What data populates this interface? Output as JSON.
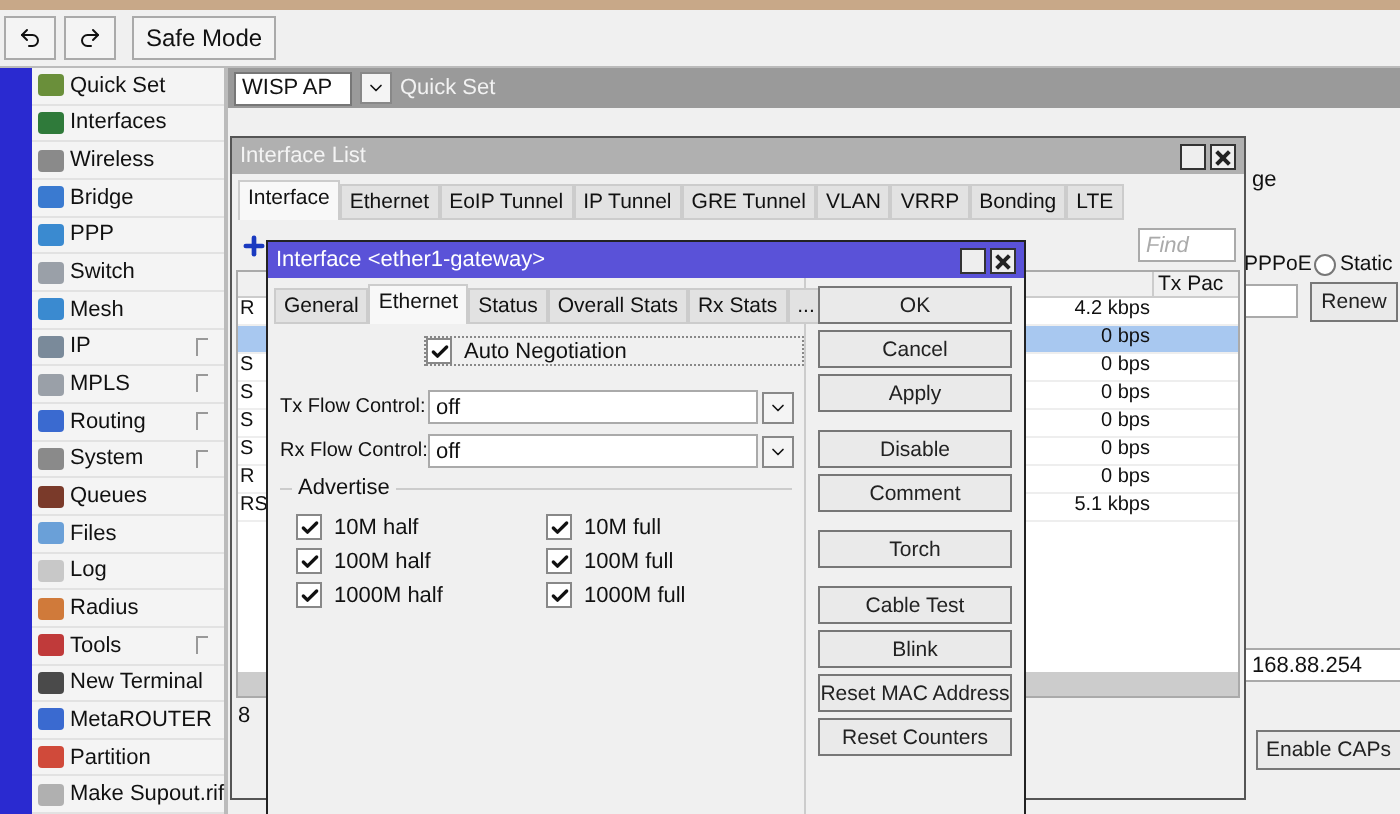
{
  "toolbar": {
    "safe_mode": "Safe Mode"
  },
  "menu": [
    {
      "label": "Quick Set",
      "color": "#6a8f3a",
      "submenu": false
    },
    {
      "label": "Interfaces",
      "color": "#2f7a3a",
      "submenu": false
    },
    {
      "label": "Wireless",
      "color": "#8a8a8a",
      "submenu": false
    },
    {
      "label": "Bridge",
      "color": "#3a7ad0",
      "submenu": false
    },
    {
      "label": "PPP",
      "color": "#3a8ad0",
      "submenu": false
    },
    {
      "label": "Switch",
      "color": "#9aa0a8",
      "submenu": false
    },
    {
      "label": "Mesh",
      "color": "#3a8ad0",
      "submenu": false
    },
    {
      "label": "IP",
      "color": "#7a8a9a",
      "submenu": true
    },
    {
      "label": "MPLS",
      "color": "#9aa0a8",
      "submenu": true
    },
    {
      "label": "Routing",
      "color": "#3a6ad0",
      "submenu": true
    },
    {
      "label": "System",
      "color": "#8a8a8a",
      "submenu": true
    },
    {
      "label": "Queues",
      "color": "#7a3a2a",
      "submenu": false
    },
    {
      "label": "Files",
      "color": "#6aa0d8",
      "submenu": false
    },
    {
      "label": "Log",
      "color": "#c8c8c8",
      "submenu": false
    },
    {
      "label": "Radius",
      "color": "#d07a3a",
      "submenu": false
    },
    {
      "label": "Tools",
      "color": "#c03a3a",
      "submenu": true
    },
    {
      "label": "New Terminal",
      "color": "#4a4a4a",
      "submenu": false
    },
    {
      "label": "MetaROUTER",
      "color": "#3a6ad0",
      "submenu": false
    },
    {
      "label": "Partition",
      "color": "#d04a3a",
      "submenu": false
    },
    {
      "label": "Make Supout.rif",
      "color": "#b0b0b0",
      "submenu": false
    }
  ],
  "quick_set": {
    "mode": "WISP AP",
    "title": "Quick Set",
    "fragments": {
      "label": "ge",
      "pppoe": "PPPoE",
      "static": {
        "label": "Static",
        "selected": false
      },
      "renew": "Renew",
      "address": "168.88.254",
      "caps": "Enable CAPs"
    }
  },
  "interface_list": {
    "title": "Interface List",
    "tabs": [
      {
        "label": "Interface",
        "selected": true
      },
      {
        "label": "Ethernet",
        "selected": false
      },
      {
        "label": "EoIP Tunnel",
        "selected": false
      },
      {
        "label": "IP Tunnel",
        "selected": false
      },
      {
        "label": "GRE Tunnel",
        "selected": false
      },
      {
        "label": "VLAN",
        "selected": false
      },
      {
        "label": "VRRP",
        "selected": false
      },
      {
        "label": "Bonding",
        "selected": false
      },
      {
        "label": "LTE",
        "selected": false
      }
    ],
    "find_placeholder": "Find",
    "column_last": "Tx Pac",
    "rows": [
      {
        "flag": "R",
        "rate": "4.2 kbps",
        "selected": false
      },
      {
        "flag": "",
        "rate": "0 bps",
        "selected": true
      },
      {
        "flag": "S",
        "rate": "0 bps",
        "selected": false
      },
      {
        "flag": "S",
        "rate": "0 bps",
        "selected": false
      },
      {
        "flag": "S",
        "rate": "0 bps",
        "selected": false
      },
      {
        "flag": "S",
        "rate": "0 bps",
        "selected": false
      },
      {
        "flag": "R",
        "rate": "0 bps",
        "selected": false
      },
      {
        "flag": "RS",
        "rate": "5.1 kbps",
        "selected": false
      }
    ],
    "status": "8"
  },
  "dialog": {
    "title": "Interface <ether1-gateway>",
    "tabs": [
      {
        "label": "General",
        "selected": false
      },
      {
        "label": "Ethernet",
        "selected": true
      },
      {
        "label": "Status",
        "selected": false
      },
      {
        "label": "Overall Stats",
        "selected": false
      },
      {
        "label": "Rx Stats",
        "selected": false
      },
      {
        "label": "...",
        "selected": false
      }
    ],
    "auto_negotiation": {
      "label": "Auto Negotiation",
      "checked": true
    },
    "fields": [
      {
        "label": "Tx Flow Control:",
        "value": "off"
      },
      {
        "label": "Rx Flow Control:",
        "value": "off"
      }
    ],
    "advertise": {
      "title": "Advertise",
      "options": [
        {
          "label": "10M half",
          "checked": true
        },
        {
          "label": "10M full",
          "checked": true
        },
        {
          "label": "100M half",
          "checked": true
        },
        {
          "label": "100M full",
          "checked": true
        },
        {
          "label": "1000M half",
          "checked": true
        },
        {
          "label": "1000M full",
          "checked": true
        }
      ]
    },
    "button_groups": [
      [
        "OK",
        "Cancel",
        "Apply"
      ],
      [
        "Disable",
        "Comment"
      ],
      [
        "Torch"
      ],
      [
        "Cable Test",
        "Blink",
        "Reset MAC Address",
        "Reset Counters"
      ]
    ]
  }
}
